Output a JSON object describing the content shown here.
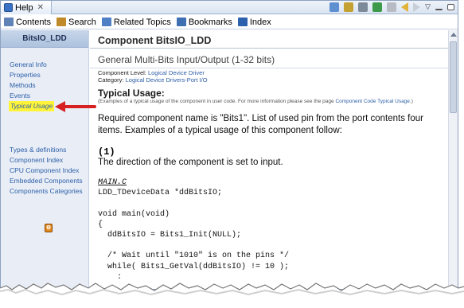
{
  "tab": {
    "title": "Help",
    "close": "✕"
  },
  "window_tools": {
    "menu": "▽"
  },
  "nav": {
    "contents": "Contents",
    "search": "Search",
    "related": "Related Topics",
    "bookmarks": "Bookmarks",
    "index": "Index"
  },
  "sidebar": {
    "header": "BitsIO_LDD",
    "group1": [
      "General Info",
      "Properties",
      "Methods",
      "Events",
      "Typical Usage"
    ],
    "group2": [
      "Types & definitions",
      "Component Index",
      "CPU Component Index",
      "Embedded Components",
      "Components Categories"
    ],
    "badge": "⚙"
  },
  "content": {
    "title": "Component BitsIO_LDD",
    "subtitle": "General Multi-Bits Input/Output (1-32 bits)",
    "level_label": "Component Level:",
    "level_value": "Logical Device Driver",
    "category_label": "Category:",
    "category_value": "Logical Device Drivers-Port I/O",
    "section_title": "Typical Usage:",
    "note_prefix": "(Examples of a typical usage of the component in user code. For more information please see the page ",
    "note_link": "Component Code Typical Usage",
    "note_suffix": ".)",
    "para": "Required component name is \"Bits1\". List of used pin from the port contents four items. Examples of a typical usage of this component follow:",
    "example_num": "(1)",
    "example_desc": "The direction of the component is set to input.",
    "code_file": "MAIN.C",
    "code_lines": [
      "LDD_TDeviceData *ddBitsIO;",
      "",
      "void main(void)",
      "{",
      "  ddBitsIO = Bits1_Init(NULL);",
      "",
      "  /* Wait until \"1010\" is on the pins */",
      "  while( Bits1_GetVal(ddBitsIO) != 10 );",
      "    :"
    ]
  },
  "colors": {
    "link": "#2d5fa8",
    "highlight": "#fff43a",
    "arrow": "#d62021",
    "sidebar_bg": "#e9eef6"
  }
}
